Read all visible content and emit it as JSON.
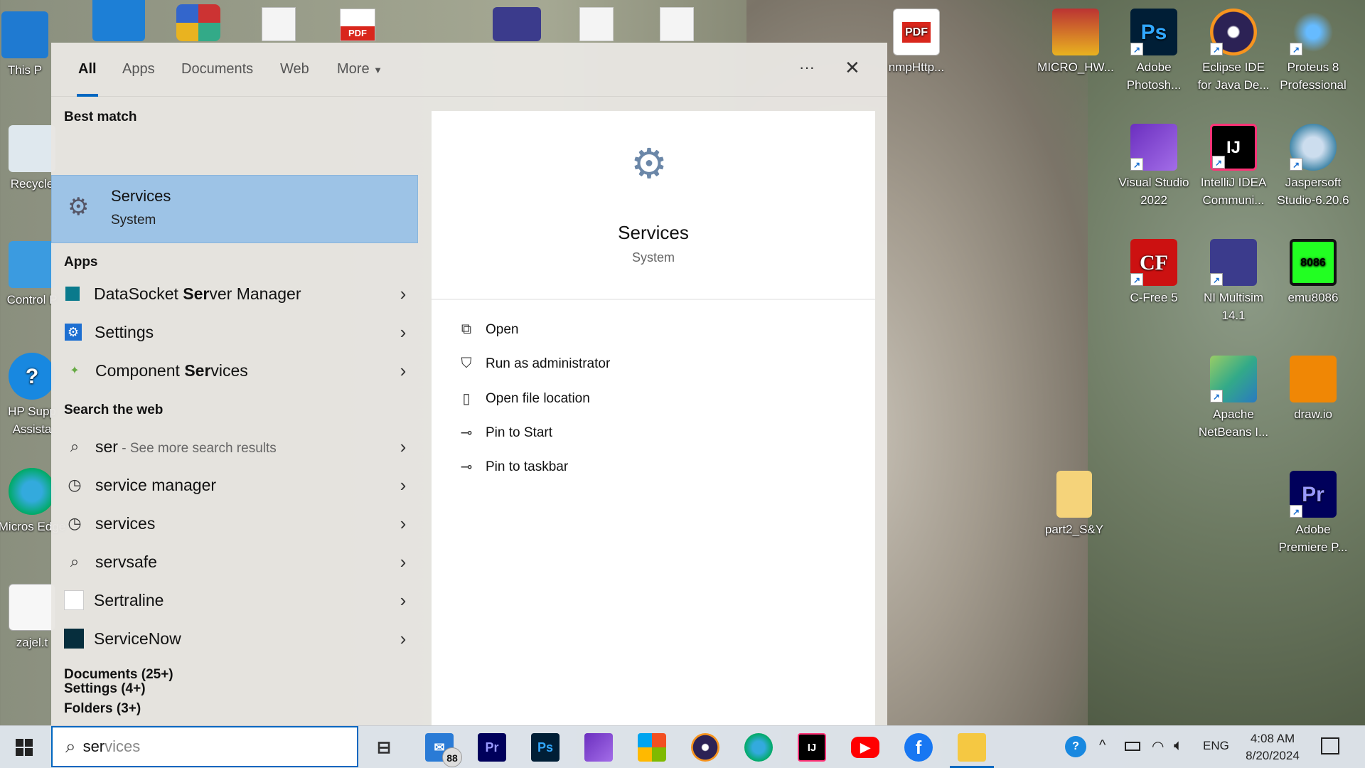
{
  "desktop_icons": [
    {
      "label": "This P",
      "icon": "pc-icon"
    },
    {
      "label": "Recycle",
      "icon": "recycle-bin-icon"
    },
    {
      "label": "Control P",
      "icon": "control-panel-icon"
    },
    {
      "label": "HP Supp Assista",
      "icon": "hp-support-icon",
      "glyph": "?"
    },
    {
      "label": "Micros Edge",
      "icon": "edge-icon"
    },
    {
      "label": "zajel.t",
      "icon": "text-file-icon"
    },
    {
      "label": "nmpHttp...",
      "icon": "pdf-icon",
      "glyph": "PDF"
    },
    {
      "label": "MICRO_HW...",
      "icon": "winrar-icon"
    },
    {
      "label": "Adobe Photosh...",
      "icon": "photoshop-icon",
      "glyph": "Ps"
    },
    {
      "label": "Eclipse IDE for Java De...",
      "icon": "eclipse-icon"
    },
    {
      "label": "Proteus 8 Professional",
      "icon": "proteus-icon"
    },
    {
      "label": "Visual Studio 2022",
      "icon": "visual-studio-icon"
    },
    {
      "label": "IntelliJ IDEA Communi...",
      "icon": "intellij-icon",
      "glyph": "IJ"
    },
    {
      "label": "Jaspersoft Studio-6.20.6",
      "icon": "jaspersoft-icon"
    },
    {
      "label": "C-Free 5",
      "icon": "cfree-icon",
      "glyph": "CF"
    },
    {
      "label": "NI Multisim 14.1",
      "icon": "multisim-icon"
    },
    {
      "label": "emu8086",
      "icon": "emu8086-icon",
      "glyph": "8086"
    },
    {
      "label": "Apache NetBeans I...",
      "icon": "netbeans-icon"
    },
    {
      "label": "draw.io",
      "icon": "drawio-icon"
    },
    {
      "label": "part2_S&Y",
      "icon": "folder-icon"
    },
    {
      "label": "Adobe Premiere P...",
      "icon": "premiere-icon",
      "glyph": "Pr"
    }
  ],
  "top_partial_icons": [
    "PDF"
  ],
  "search": {
    "tabs": [
      "All",
      "Apps",
      "Documents",
      "Web",
      "More"
    ],
    "more_glyph": "···",
    "close_glyph": "✕",
    "best_match_header": "Best match",
    "best_match": {
      "title": "Services",
      "subtitle": "System"
    },
    "apps_header": "Apps",
    "apps": [
      {
        "pre": "DataSocket ",
        "bold": "Ser",
        "post": "ver Manager",
        "icon": "datasocket-icon"
      },
      {
        "pre": "Settings",
        "bold": "",
        "post": "",
        "icon": "settings-icon"
      },
      {
        "pre": "Component ",
        "bold": "Ser",
        "post": "vices",
        "icon": "component-services-icon"
      }
    ],
    "web_header": "Search the web",
    "web": [
      {
        "label": "ser",
        "sub": " - See more search results",
        "icon": "search-icon"
      },
      {
        "label": "service manager",
        "sub": "",
        "icon": "history-icon"
      },
      {
        "label": "services",
        "sub": "",
        "icon": "history-icon"
      },
      {
        "label": "servsafe",
        "sub": "",
        "icon": "search-icon"
      },
      {
        "label": "Sertraline",
        "sub": "",
        "icon": "sertraline-icon"
      },
      {
        "label": "ServiceNow",
        "sub": "",
        "icon": "servicenow-icon"
      }
    ],
    "documents": "Documents (25+)",
    "folders": "Folders (3+)",
    "settings": "Settings (4+)",
    "preview": {
      "title": "Services",
      "subtitle": "System"
    },
    "actions": [
      {
        "label": "Open",
        "icon": "open-icon"
      },
      {
        "label": "Run as administrator",
        "icon": "shield-icon"
      },
      {
        "label": "Open file location",
        "icon": "file-location-icon"
      },
      {
        "label": "Pin to Start",
        "icon": "pin-icon"
      },
      {
        "label": "Pin to taskbar",
        "icon": "pin-icon"
      }
    ],
    "query_typed": "ser",
    "query_suggest": "vices"
  },
  "taskbar": {
    "mail_badge": "88",
    "language": "ENG",
    "time": "4:08 AM",
    "date": "8/20/2024",
    "icons": [
      "task-view-icon",
      "mail-icon",
      "premiere-icon",
      "photoshop-icon",
      "visual-studio-icon",
      "store-icon",
      "eclipse-icon",
      "edge-icon",
      "intellij-icon",
      "youtube-icon",
      "facebook-icon",
      "file-explorer-icon"
    ],
    "glyphs": {
      "premiere": "Pr",
      "photoshop": "Ps",
      "intellij": "IJ",
      "facebook": "f"
    }
  },
  "colors": {
    "accent": "#0067c0",
    "best_match_bg": "#9dc3e6"
  }
}
